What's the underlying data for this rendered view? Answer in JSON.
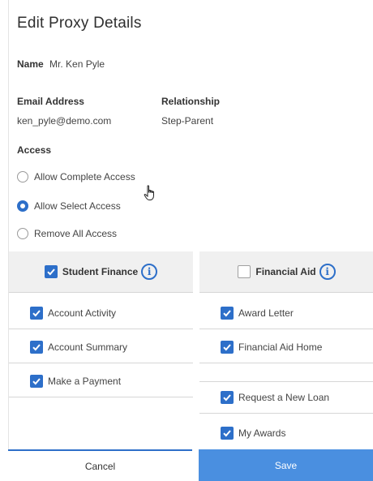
{
  "dialog": {
    "title": "Edit Proxy Details",
    "name_label": "Name",
    "name_value": "Mr. Ken Pyle",
    "email_label": "Email Address",
    "email_value": "ken_pyle@demo.com",
    "relationship_label": "Relationship",
    "relationship_value": "Step-Parent",
    "access_label": "Access",
    "access_options": [
      {
        "label": "Allow Complete Access",
        "selected": false
      },
      {
        "label": "Allow Select Access",
        "selected": true
      },
      {
        "label": "Remove All Access",
        "selected": false
      }
    ],
    "columns": [
      {
        "header": "Student Finance",
        "header_checked": true,
        "info_icon": "info-icon",
        "items": [
          {
            "label": "Account Activity",
            "checked": true
          },
          {
            "label": "Account Summary",
            "checked": true
          },
          {
            "label": "Make a Payment",
            "checked": true
          }
        ]
      },
      {
        "header": "Financial Aid",
        "header_checked": false,
        "info_icon": "info-icon",
        "items": [
          {
            "label": "Award Letter",
            "checked": true
          },
          {
            "label": "Financial Aid Home",
            "checked": true
          },
          {
            "label": "Request a New Loan",
            "checked": true
          },
          {
            "label": "My Awards",
            "checked": true
          }
        ]
      }
    ],
    "buttons": {
      "cancel_label": "Cancel",
      "save_label": "Save"
    }
  },
  "colors": {
    "accent": "#2d6fc9",
    "save_button": "#4a8fe0",
    "header_bg": "#f0f0f0"
  },
  "icons": {
    "cursor": "hand-pointer-icon",
    "check": "check-icon",
    "info": "info-icon"
  }
}
